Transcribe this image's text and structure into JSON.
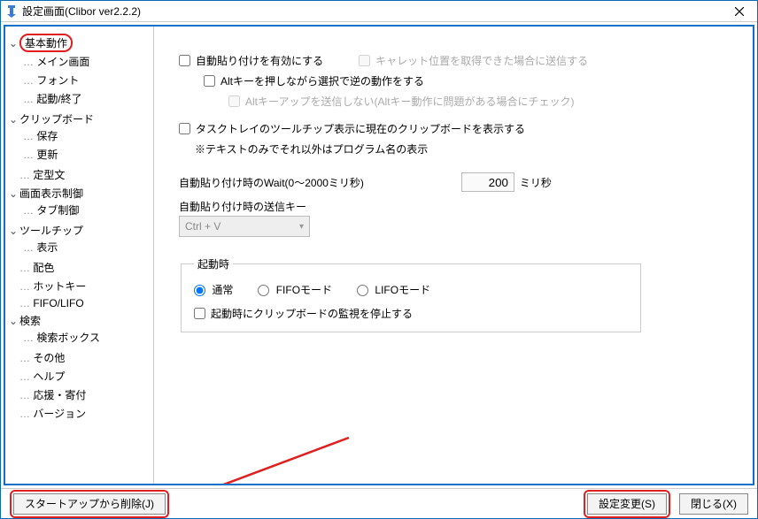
{
  "window": {
    "title": "設定画面(Clibor ver2.2.2)"
  },
  "sidebar": {
    "items": [
      {
        "label": "基本動作",
        "expandable": true,
        "selected": true,
        "children": [
          {
            "label": "メイン画面"
          },
          {
            "label": "フォント"
          },
          {
            "label": "起動/終了"
          }
        ]
      },
      {
        "label": "クリップボード",
        "expandable": true,
        "children": [
          {
            "label": "保存"
          },
          {
            "label": "更新"
          }
        ]
      },
      {
        "label": "定型文",
        "expandable": false
      },
      {
        "label": "画面表示制御",
        "expandable": true,
        "children": [
          {
            "label": "タブ制御"
          }
        ]
      },
      {
        "label": "ツールチップ",
        "expandable": true,
        "children": [
          {
            "label": "表示"
          }
        ]
      },
      {
        "label": "配色",
        "expandable": false
      },
      {
        "label": "ホットキー",
        "expandable": false
      },
      {
        "label": "FIFO/LIFO",
        "expandable": false
      },
      {
        "label": "検索",
        "expandable": true,
        "children": [
          {
            "label": "検索ボックス"
          }
        ]
      },
      {
        "label": "その他",
        "expandable": false
      },
      {
        "label": "ヘルプ",
        "expandable": false
      },
      {
        "label": "応援・寄付",
        "expandable": false
      },
      {
        "label": "バージョン",
        "expandable": false
      }
    ]
  },
  "main": {
    "auto_paste_enable": "自動貼り付けを有効にする",
    "caret_send": "キャレット位置を取得できた場合に送信する",
    "alt_reverse": "Altキーを押しながら選択で逆の動作をする",
    "alt_keyup_skip": "Altキーアップを送信しない(Altキー動作に問題がある場合にチェック)",
    "tasktray_tooltip": "タスクトレイのツールチップ表示に現在のクリップボードを表示する",
    "tasktray_note": "※テキストのみでそれ以外はプログラム名の表示",
    "wait_label": "自動貼り付け時のWait(0～2000ミリ秒)",
    "wait_value": "200",
    "wait_unit": "ミリ秒",
    "sendkey_label": "自動貼り付け時の送信キー",
    "sendkey_value": "Ctrl + V",
    "startup": {
      "legend": "起動時",
      "normal": "通常",
      "fifo": "FIFOモード",
      "lifo": "LIFOモード",
      "stop_monitor": "起動時にクリップボードの監視を停止する"
    }
  },
  "footer": {
    "startup_delete": "スタートアップから削除(J)",
    "apply": "設定変更(S)",
    "close": "閉じる(X)"
  }
}
